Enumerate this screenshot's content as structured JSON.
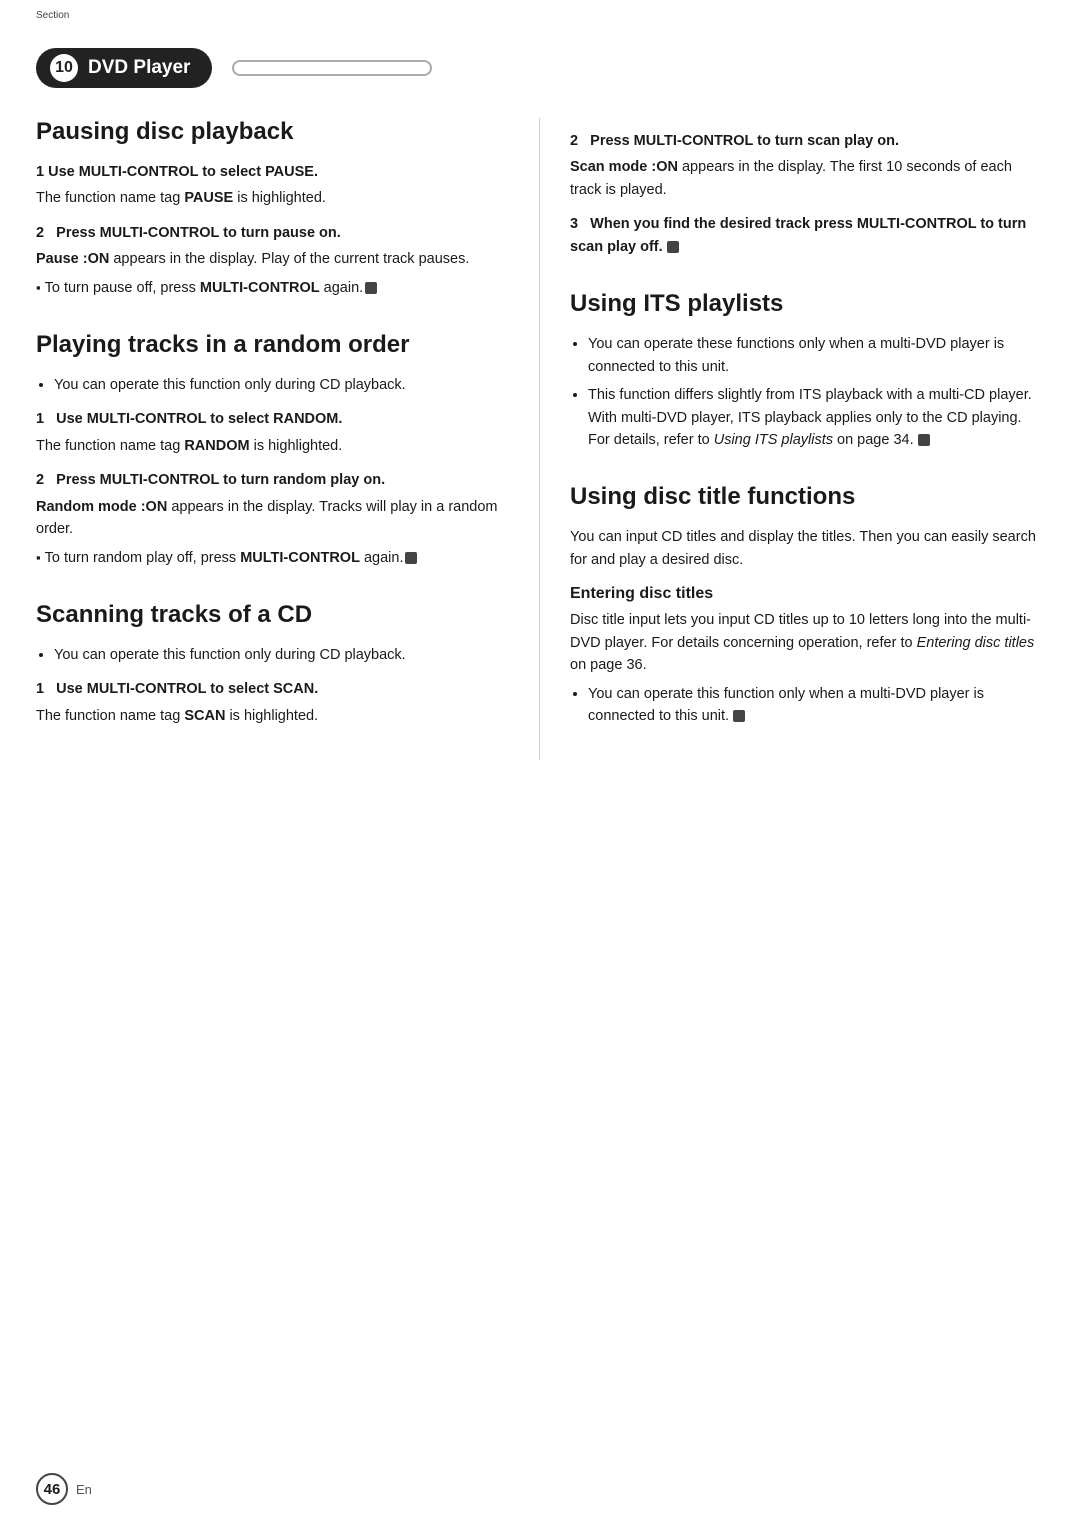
{
  "header": {
    "section_label": "Section",
    "section_number": "10",
    "section_title": "DVD Player",
    "right_box": ""
  },
  "left_column": {
    "pausing_disc_playback": {
      "title": "Pausing disc playback",
      "step1_heading": "1   Use MULTI-CONTROL to select PAUSE.",
      "step1_text": "The function name tag ",
      "step1_bold": "PAUSE",
      "step1_suffix": " is highlighted.",
      "step2_heading": "2   Press MULTI-CONTROL to turn pause on.",
      "step2_para1_bold": "Pause :ON",
      "step2_para1_text": " appears in the display. Play of the current track pauses.",
      "step2_note_bullet": "▪",
      "step2_note_text": "To turn pause off, press ",
      "step2_note_bold": "MULTI-CONTROL",
      "step2_note_suffix": " again."
    },
    "playing_tracks": {
      "title": "Playing tracks in a random order",
      "bullet1": "You can operate this function only during CD playback.",
      "step1_heading": "1   Use MULTI-CONTROL to select RANDOM.",
      "step1_text": "The function name tag ",
      "step1_bold": "RANDOM",
      "step1_suffix": " is highlighted.",
      "step2_heading": "2   Press MULTI-CONTROL to turn random play on.",
      "step2_para1_bold": "Random mode :ON",
      "step2_para1_text": " appears in the display. Tracks will play in a random order.",
      "step2_note_bullet": "▪",
      "step2_note_text": "To turn random play off, press",
      "step2_note_bold": "MULTI-CONTROL",
      "step2_note_suffix": " again."
    },
    "scanning_tracks": {
      "title": "Scanning tracks of a CD",
      "bullet1": "You can operate this function only during CD playback.",
      "step1_heading": "1   Use MULTI-CONTROL to select SCAN.",
      "step1_text": "The function name tag ",
      "step1_bold": "SCAN",
      "step1_suffix": " is highlighted."
    }
  },
  "right_column": {
    "scanning_continued": {
      "step2_heading": "2   Press MULTI-CONTROL to turn scan play on.",
      "step2_para1_bold": "Scan mode :ON",
      "step2_para1_text": " appears in the display. The first 10 seconds of each track is played.",
      "step3_heading": "3   When you find the desired track press MULTI-CONTROL to turn scan play off."
    },
    "using_its": {
      "title": "Using ITS playlists",
      "bullet1": "You can operate these functions only when a multi-DVD player is connected to this unit.",
      "bullet2": "This function differs slightly from ITS playback with a multi-CD player. With multi-DVD player, ITS playback applies only to the CD playing. For details, refer to ",
      "bullet2_italic": "Using ITS playlists",
      "bullet2_suffix": " on page 34."
    },
    "using_disc_title": {
      "title": "Using disc title functions",
      "intro": "You can input CD titles and display the titles. Then you can easily search for and play a desired disc.",
      "sub_heading": "Entering disc titles",
      "sub_intro": "Disc title input lets you input CD titles up to 10 letters long into the multi-DVD player. For details concerning operation, refer to ",
      "sub_intro_italic": "Entering disc titles",
      "sub_intro_suffix": " on page 36.",
      "bullet1": "You can operate this function only when a multi-DVD player is connected to this unit."
    }
  },
  "footer": {
    "page_number": "46",
    "language": "En"
  }
}
